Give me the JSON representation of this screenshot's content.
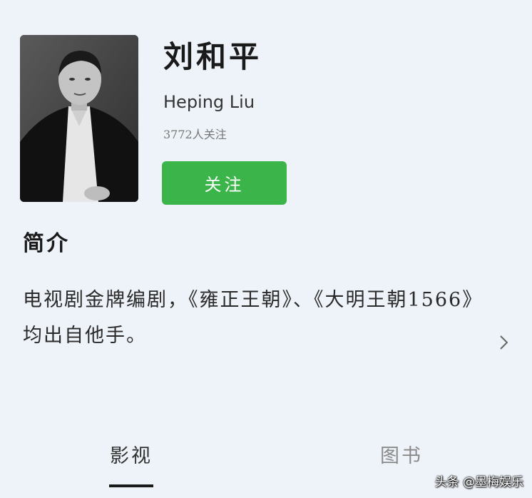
{
  "profile": {
    "name": "刘和平",
    "name_en": "Heping Liu",
    "followers": "3772人关注",
    "follow_label": "关注"
  },
  "intro": {
    "title": "简介",
    "text": "电视剧金牌编剧，《雍正王朝》、《大明王朝1566》均出自他手。"
  },
  "tabs": [
    {
      "label": "影视",
      "active": true
    },
    {
      "label": "图书",
      "active": false
    }
  ],
  "watermark": "头条 @墨梅娱乐",
  "colors": {
    "background": "#eef3f9",
    "follow_button": "#3bb54a",
    "tab_active": "#333333",
    "tab_inactive": "#8a8a8a"
  },
  "icons": {
    "expand": "chevron-right-icon"
  }
}
